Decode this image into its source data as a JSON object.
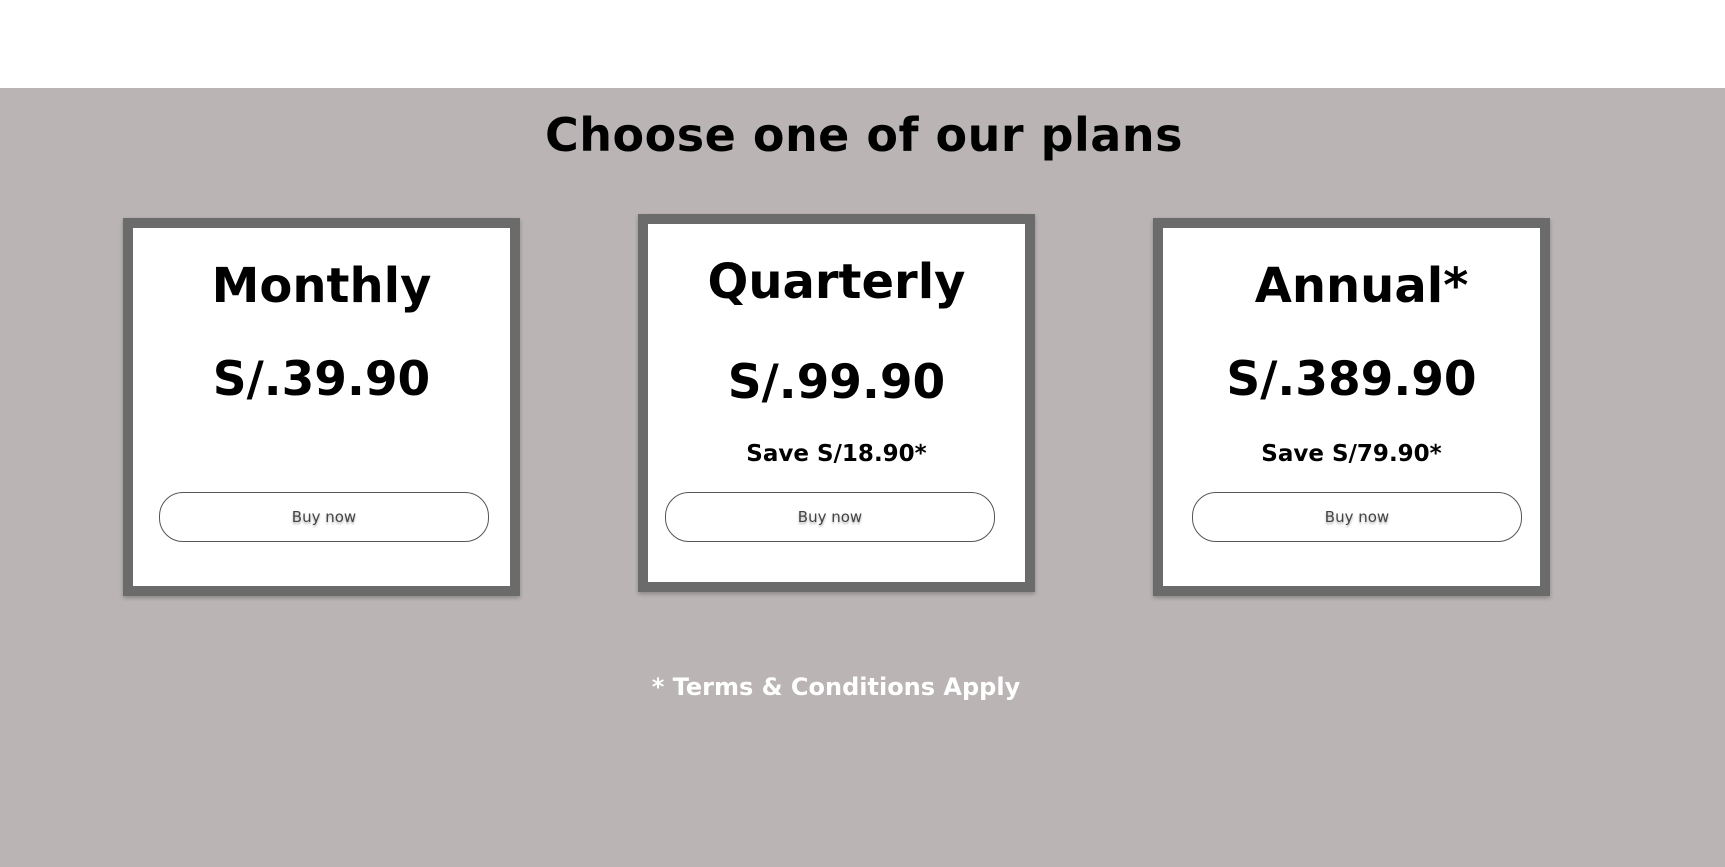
{
  "section": {
    "title": "Choose one of our plans"
  },
  "plans": [
    {
      "name": "Monthly",
      "price": "S/.39.90",
      "savings": "",
      "button_label": "Buy now"
    },
    {
      "name": "Quarterly",
      "price": "S/.99.90",
      "savings": "Save S/18.90*",
      "button_label": "Buy now"
    },
    {
      "name": "Annual*",
      "price": "S/.389.90",
      "savings": "Save S/79.90*",
      "button_label": "Buy now"
    }
  ],
  "footer": {
    "terms": "* Terms & Conditions Apply"
  },
  "colors": {
    "section_background": "#bab4b4",
    "card_border": "#6b6b6b",
    "card_background": "#ffffff",
    "terms_text": "#ffffff"
  }
}
